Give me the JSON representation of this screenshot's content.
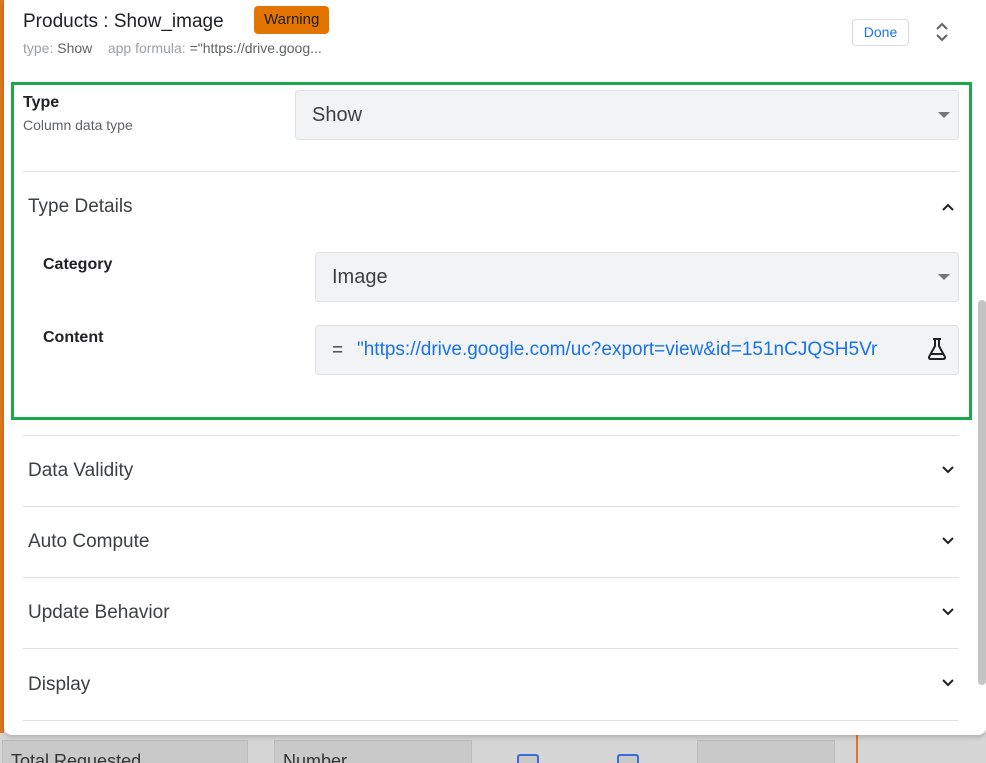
{
  "header": {
    "title": "Products : Show_image",
    "warning_badge": "Warning",
    "subtitle_type_label": "type:",
    "subtitle_type_value": "Show",
    "subtitle_formula_label": "app formula:",
    "subtitle_formula_value": "=\"https://drive.goog...",
    "done_label": "Done"
  },
  "type_field": {
    "label": "Type",
    "sublabel": "Column data type",
    "value": "Show"
  },
  "type_details": {
    "title": "Type Details",
    "category_label": "Category",
    "category_value": "Image",
    "content_label": "Content",
    "content_eq": "=",
    "content_formula": "\"https://drive.google.com/uc?export=view&id=151nCJQSH5Vr"
  },
  "sections": [
    {
      "title": "Data Validity"
    },
    {
      "title": "Auto Compute"
    },
    {
      "title": "Update Behavior"
    },
    {
      "title": "Display"
    }
  ],
  "background": {
    "cell1": "Total Requested",
    "cell2": "Number"
  },
  "colors": {
    "accent_green": "#1ba84a",
    "warning_orange": "#e37400",
    "link_blue": "#1a73e8"
  }
}
